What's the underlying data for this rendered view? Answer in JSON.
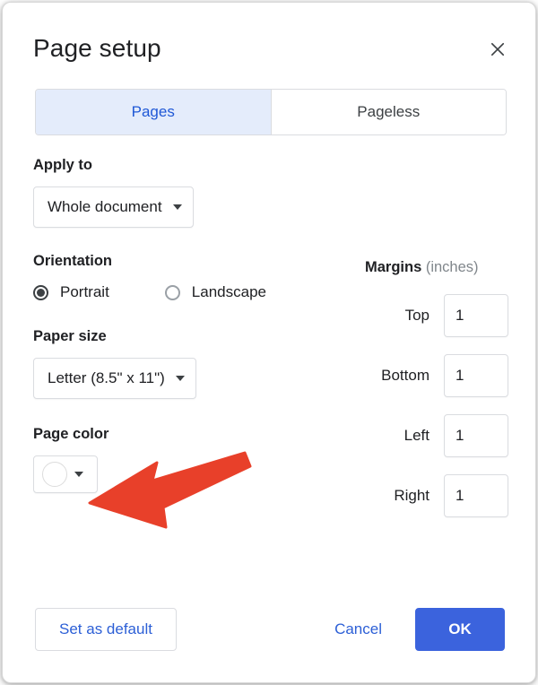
{
  "dialog": {
    "title": "Page setup",
    "close_icon": "close-icon"
  },
  "tabs": [
    {
      "label": "Pages",
      "active": true
    },
    {
      "label": "Pageless",
      "active": false
    }
  ],
  "apply_to": {
    "label": "Apply to",
    "value": "Whole document",
    "caret_icon": "chevron-down-icon"
  },
  "orientation": {
    "label": "Orientation",
    "options": [
      {
        "label": "Portrait",
        "selected": true
      },
      {
        "label": "Landscape",
        "selected": false
      }
    ]
  },
  "paper_size": {
    "label": "Paper size",
    "value": "Letter (8.5\" x 11\")",
    "caret_icon": "chevron-down-icon"
  },
  "page_color": {
    "label": "Page color",
    "swatch_color": "#ffffff",
    "caret_icon": "chevron-down-icon"
  },
  "margins": {
    "heading_bold": "Margins",
    "heading_unit": " (inches)",
    "fields": [
      {
        "label": "Top",
        "value": "1"
      },
      {
        "label": "Bottom",
        "value": "1"
      },
      {
        "label": "Left",
        "value": "1"
      },
      {
        "label": "Right",
        "value": "1"
      }
    ]
  },
  "footer": {
    "set_default_label": "Set as default",
    "cancel_label": "Cancel",
    "ok_label": "OK"
  },
  "annotation": {
    "arrow_color": "#e8402a",
    "points_to": "page-color-button"
  },
  "colors": {
    "accent_blue": "#3b63dd",
    "tab_active_bg": "#e4ecfb",
    "tab_active_text": "#1f58d6",
    "border": "#dadce0",
    "text_primary": "#202124",
    "text_muted": "#80868b",
    "annotation_red": "#e8402a"
  }
}
